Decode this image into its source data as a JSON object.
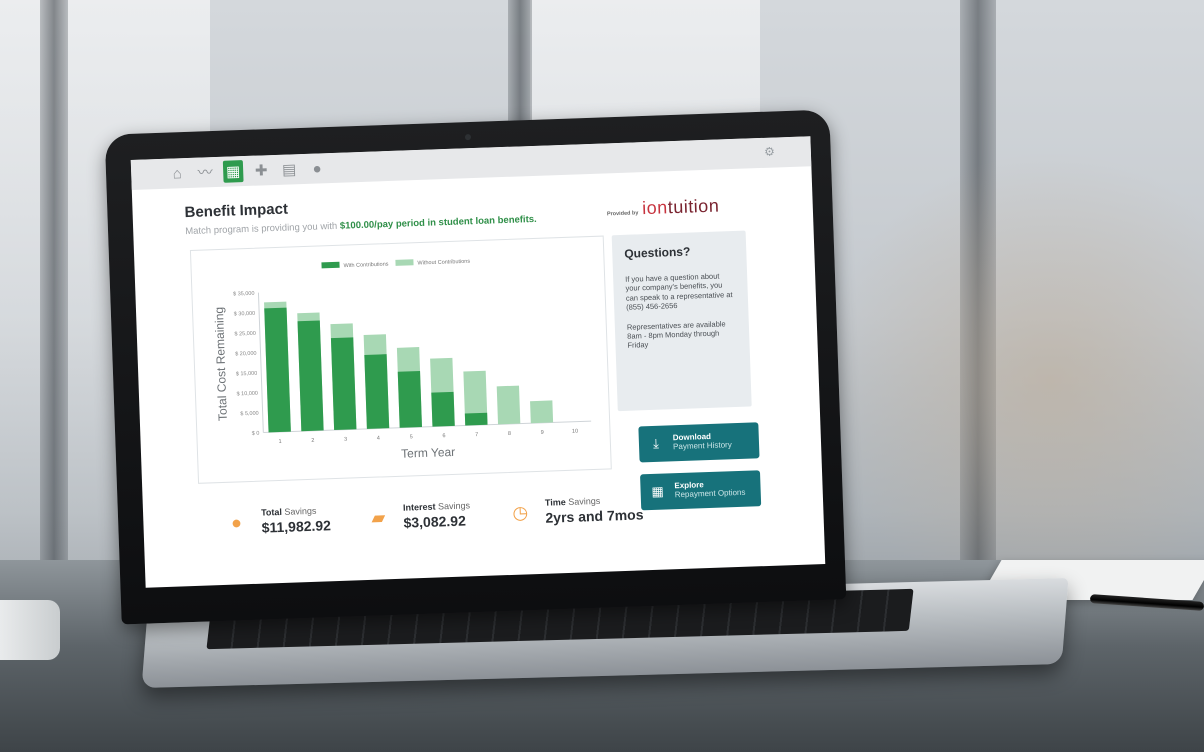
{
  "nav": {
    "icons": [
      "graduation-cap-icon",
      "activity-icon",
      "loan-doc-icon",
      "piggy-icon",
      "document-icon",
      "bag-icon"
    ],
    "glyphs": [
      "⌂",
      "〰",
      "▦",
      "✚",
      "▤",
      "●"
    ],
    "settings_glyph": "⚙"
  },
  "header": {
    "title": "Benefit Impact",
    "subtitle_prefix": "Match program is providing you with ",
    "subtitle_highlight": "$100.00/pay period in student loan benefits.",
    "provided_by": "Provided by",
    "logo_prefix": "ion",
    "logo_suffix": "tuition"
  },
  "chart_data": {
    "type": "bar",
    "title": "",
    "xlabel": "Term Year",
    "ylabel": "Total Cost Remaining",
    "categories": [
      "1",
      "2",
      "3",
      "4",
      "5",
      "6",
      "7",
      "8",
      "9",
      "10"
    ],
    "ylim": [
      0,
      35000
    ],
    "yticks": [
      "$ 0",
      "$ 5,000",
      "$ 10,000",
      "$ 15,000",
      "$ 20,000",
      "$ 25,000",
      "$ 30,000",
      "$ 35,000"
    ],
    "ytick_values": [
      0,
      5000,
      10000,
      15000,
      20000,
      25000,
      30000,
      35000
    ],
    "series": [
      {
        "name": "With Contributions",
        "values": [
          31000,
          27500,
          23000,
          18500,
          14000,
          8500,
          3000,
          0,
          0,
          0
        ],
        "color": "#2f9b4e"
      },
      {
        "name": "Without Contributions",
        "values": [
          32500,
          29500,
          26500,
          23500,
          20000,
          17000,
          13500,
          9500,
          5500,
          0
        ],
        "color": "#a8d8b4"
      }
    ],
    "legend_position": "top-center",
    "grid": false
  },
  "questions": {
    "title": "Questions?",
    "para1": "If you have a question about your company's benefits, you can speak to a representative at (855) 456-2656",
    "para2": "Representatives are available 8am - 8pm Monday through Friday"
  },
  "buttons": {
    "download_l1": "Download",
    "download_l2": "Payment History",
    "explore_l1": "Explore",
    "explore_l2": "Repayment Options"
  },
  "stats": [
    {
      "bold": "Total",
      "rest": " Savings",
      "value": "$11,982.92",
      "icon": "piggy-bank-icon",
      "color": "#f2a24a"
    },
    {
      "bold": "Interest",
      "rest": " Savings",
      "value": "$3,082.92",
      "icon": "money-icon",
      "color": "#f2a24a"
    },
    {
      "bold": "Time",
      "rest": " Savings",
      "value": "2yrs and 7mos",
      "icon": "clock-icon",
      "color": "#f2a24a"
    }
  ]
}
